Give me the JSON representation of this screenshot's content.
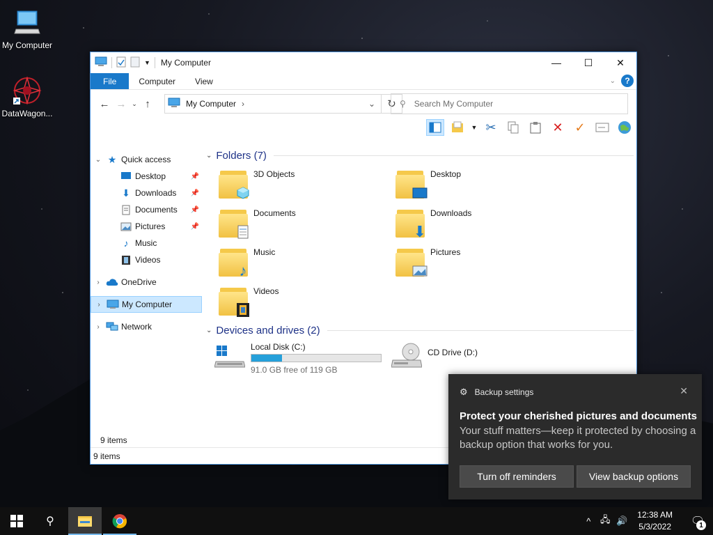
{
  "desktop": {
    "icons": [
      {
        "label": "My Computer",
        "icon": "computer-icon"
      },
      {
        "label": "DataWagon...",
        "icon": "datawagon-app-icon"
      }
    ]
  },
  "window": {
    "title": "My Computer",
    "controls": {
      "minimize": "—",
      "maximize": "☐",
      "close": "✕"
    },
    "tabs": [
      "File",
      "Computer",
      "View"
    ],
    "address": {
      "crumb": "My Computer"
    },
    "search_placeholder": "Search My Computer",
    "sidebar": {
      "quick_access": "Quick access",
      "quick_items": [
        {
          "label": "Desktop",
          "icon": "desktop-icon"
        },
        {
          "label": "Downloads",
          "icon": "downloads-icon"
        },
        {
          "label": "Documents",
          "icon": "documents-icon"
        },
        {
          "label": "Pictures",
          "icon": "pictures-icon"
        },
        {
          "label": "Music",
          "icon": "music-icon"
        },
        {
          "label": "Videos",
          "icon": "videos-icon"
        }
      ],
      "onedrive": "OneDrive",
      "my_computer": "My Computer",
      "network": "Network"
    },
    "folders_header": "Folders (7)",
    "folders": [
      {
        "name": "3D Objects",
        "emblem": "cube-icon"
      },
      {
        "name": "Desktop",
        "emblem": "desktop-icon"
      },
      {
        "name": "Documents",
        "emblem": "document-icon"
      },
      {
        "name": "Downloads",
        "emblem": "down-arrow-icon"
      },
      {
        "name": "Music",
        "emblem": "music-note-icon"
      },
      {
        "name": "Pictures",
        "emblem": "landscape-icon"
      },
      {
        "name": "Videos",
        "emblem": "film-icon"
      }
    ],
    "devices_header": "Devices and drives (2)",
    "drives": [
      {
        "name": "Local Disk (C:)",
        "free": "91.0 GB free of 119 GB",
        "used_fraction": 0.235
      },
      {
        "name": "CD Drive (D:)"
      }
    ],
    "items_count": "9 items",
    "status_text": "9 items"
  },
  "toast": {
    "app": "Backup settings",
    "title": "Protect your cherished pictures and documents",
    "body": "Your stuff matters—keep it protected by choosing a backup option that works for you.",
    "btn_off": "Turn off reminders",
    "btn_view": "View backup options"
  },
  "taskbar": {
    "time": "12:38 AM",
    "date": "5/3/2022",
    "notification_count": "1"
  },
  "colors": {
    "accent": "#1979ca",
    "selection": "#cce8ff",
    "toast_bg": "#2b2b2b",
    "header_text": "#1e3287",
    "progress": "#26a0da"
  }
}
